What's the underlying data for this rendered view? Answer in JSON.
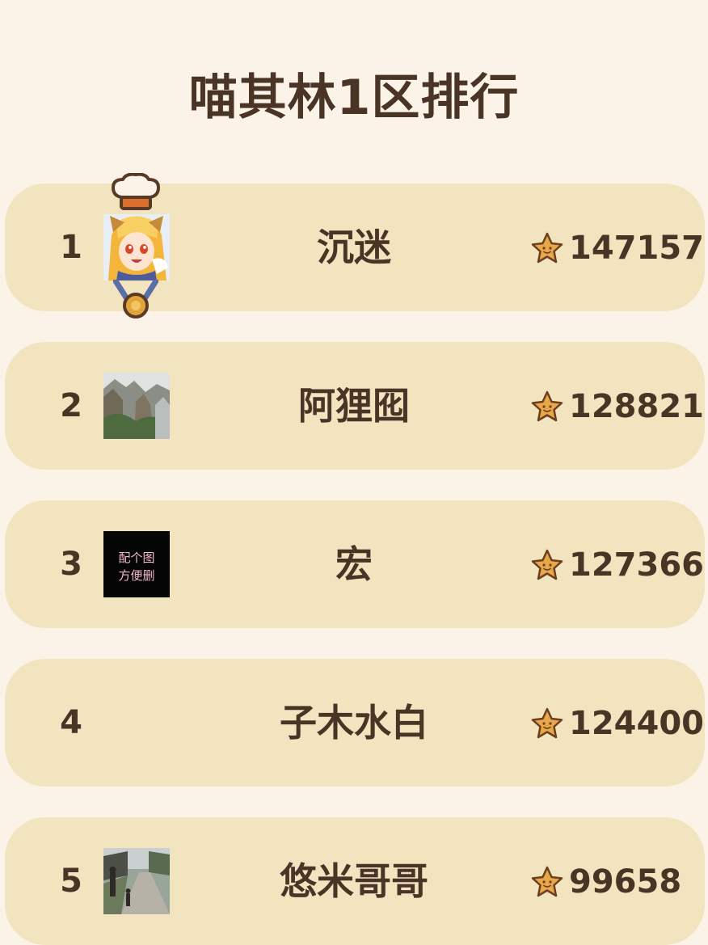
{
  "page": {
    "title": "喵其林1区排行"
  },
  "rankings": [
    {
      "rank": "1",
      "name": "沉迷",
      "score": "147157",
      "avatar": "anime-girl-avatar",
      "badges": [
        "chef-hat-icon",
        "medal-icon"
      ]
    },
    {
      "rank": "2",
      "name": "阿狸囮",
      "score": "128821",
      "avatar": "mountain-landscape-avatar"
    },
    {
      "rank": "3",
      "name": "宏",
      "score": "127366",
      "avatar": "text-avatar",
      "avatar_text": [
        "配个图",
        "方便删"
      ]
    },
    {
      "rank": "4",
      "name": "子木水白",
      "score": "124400",
      "avatar": "none"
    },
    {
      "rank": "5",
      "name": "悠米哥哥",
      "score": "99658",
      "avatar": "park-path-avatar"
    }
  ],
  "icons": {
    "score": "star-face-icon",
    "top_badge": "chef-hat-icon",
    "bottom_badge": "medal-icon"
  },
  "colors": {
    "background": "#fbf3e7",
    "row_background": "#f3e4c0",
    "text": "#4a3426",
    "star": "#e8a84a",
    "star_outline": "#6b3f1f",
    "medal": "#e2a33b"
  }
}
